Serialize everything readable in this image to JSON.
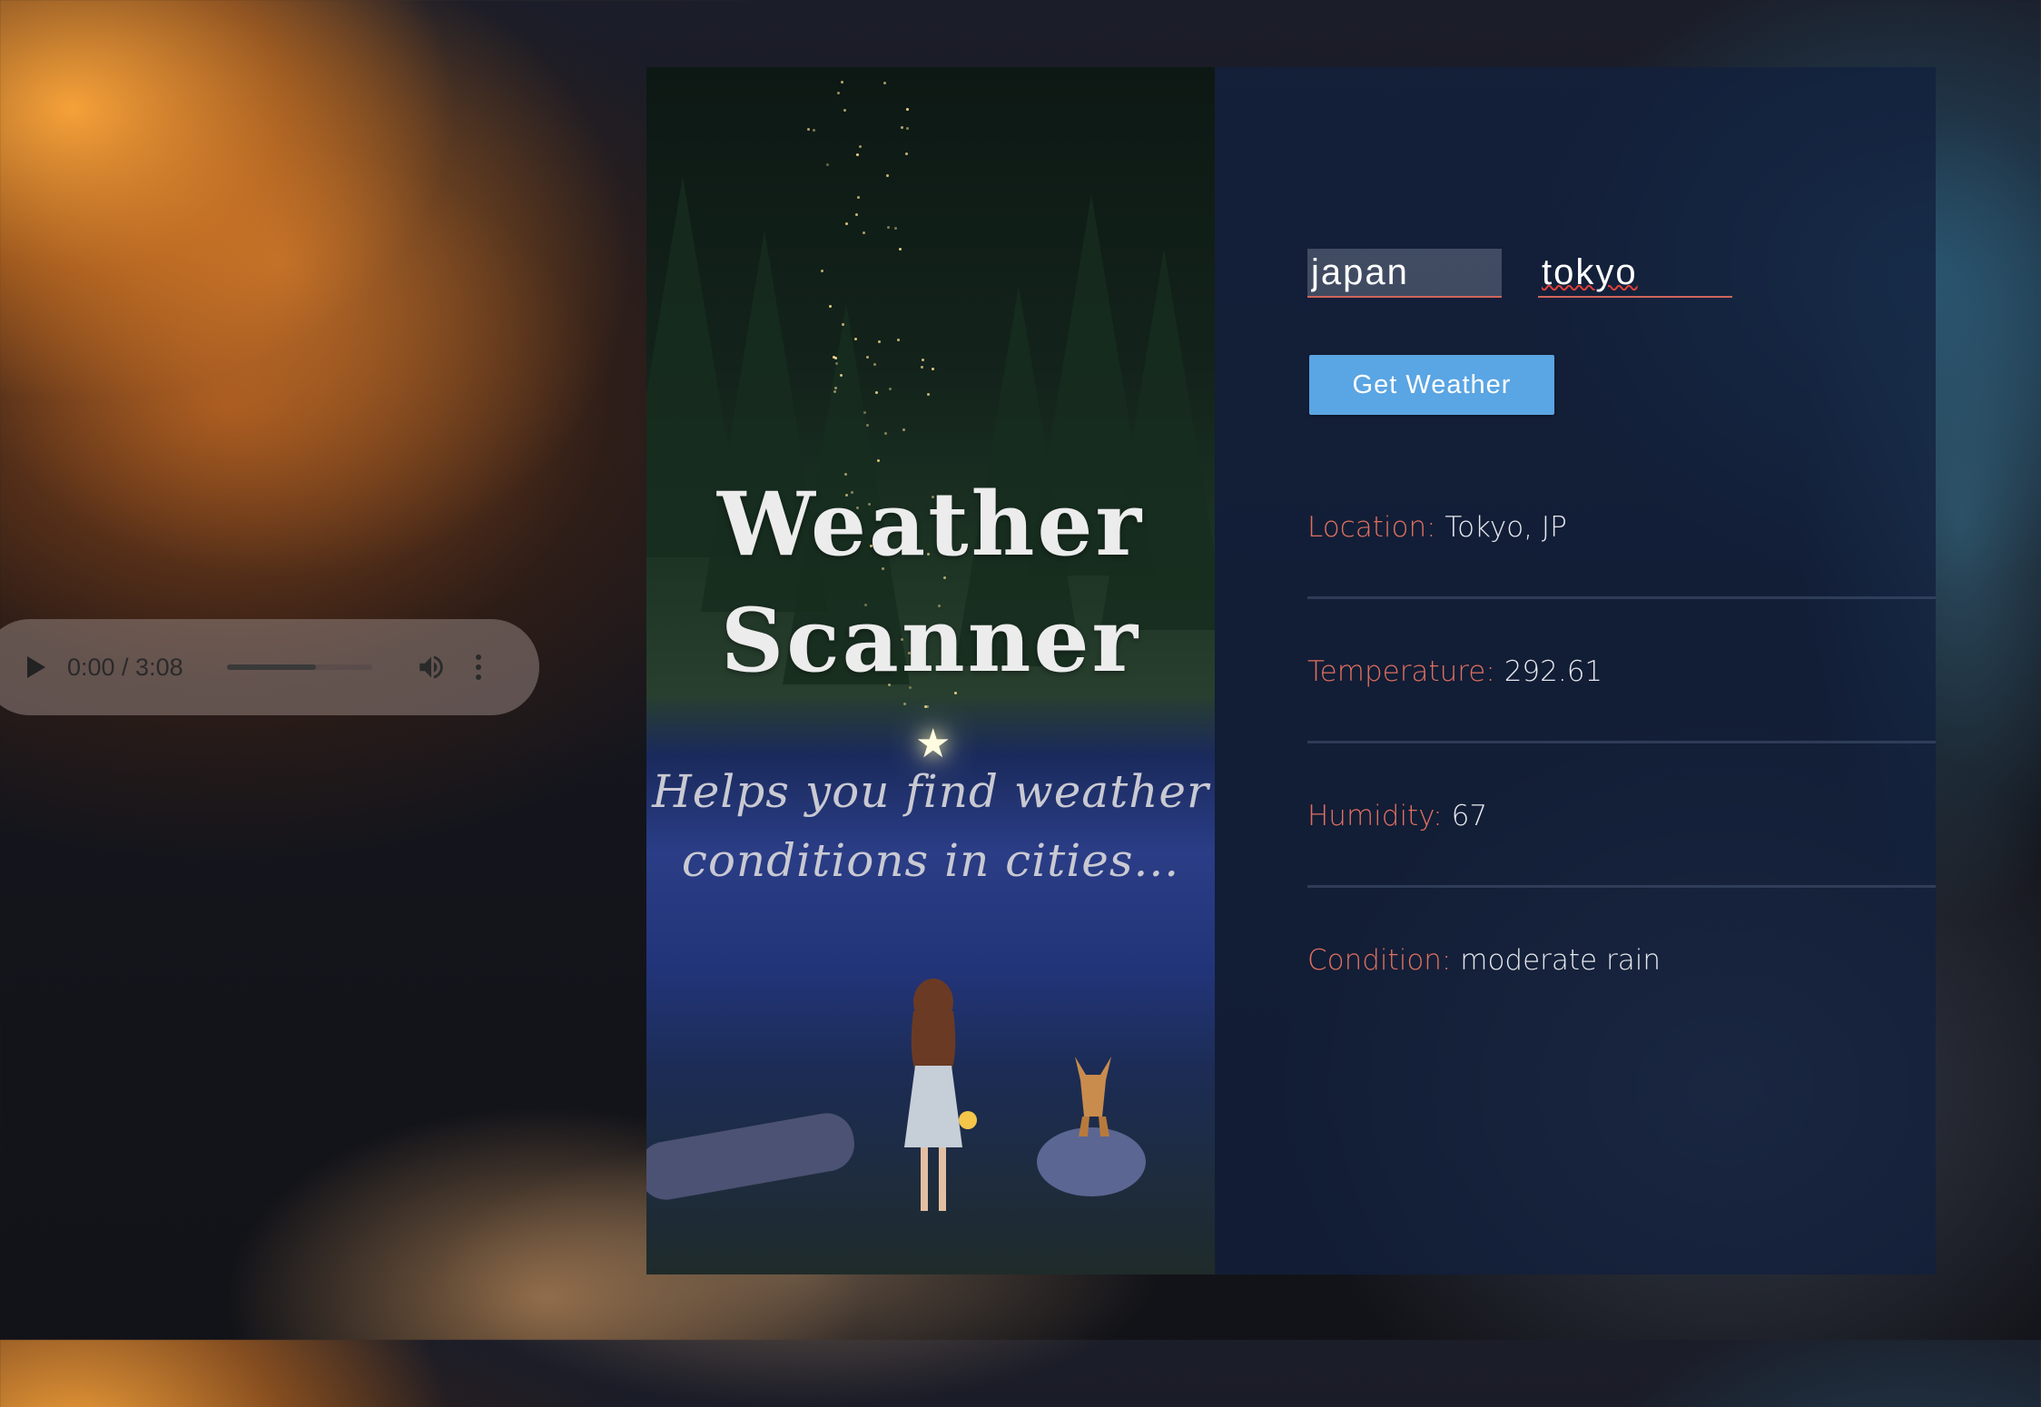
{
  "audio": {
    "time_display": "0:00 / 3:08",
    "progress_fraction": 0.61,
    "play_icon": "play-icon",
    "volume_icon": "volume-icon",
    "more_icon": "more-vert-icon"
  },
  "hero": {
    "title_line1": "Weather",
    "title_line2": "Scanner",
    "subtitle_line1": "Helps you find weather",
    "subtitle_line2": "conditions in cities..."
  },
  "form": {
    "country_value": "japan",
    "city_value": "tokyo",
    "submit_label": "Get Weather"
  },
  "results": [
    {
      "label": "Location:",
      "value": "Tokyo, JP"
    },
    {
      "label": "Temperature:",
      "value": "292.61"
    },
    {
      "label": "Humidity:",
      "value": "67"
    },
    {
      "label": "Condition:",
      "value": "moderate rain"
    }
  ],
  "colors": {
    "label_accent": "#e0705f",
    "button_bg": "#5aa5e3",
    "panel_bg": "#12203e"
  }
}
